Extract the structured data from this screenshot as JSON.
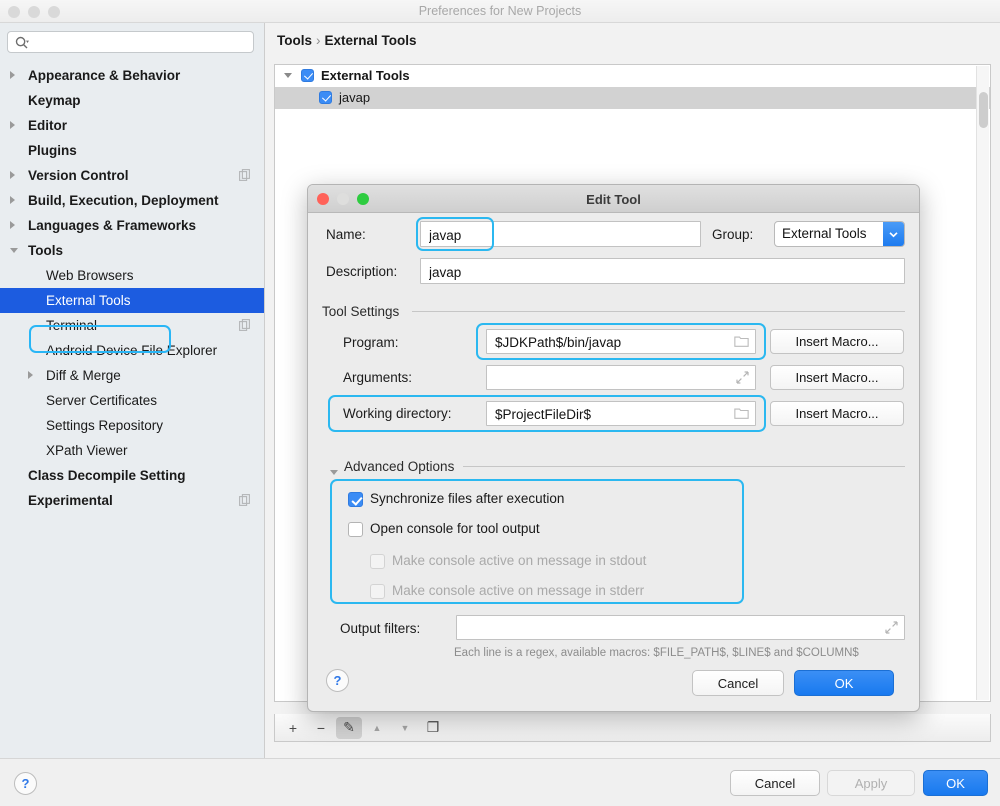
{
  "window": {
    "title": "Preferences for New Projects"
  },
  "search": {
    "value": "",
    "placeholder": ""
  },
  "sidebar": {
    "items": [
      {
        "label": "Appearance & Behavior",
        "level": "top",
        "arrow": "right",
        "bold": true,
        "copy": false,
        "selected": false
      },
      {
        "label": "Keymap",
        "level": "top",
        "arrow": "none",
        "bold": true,
        "copy": false,
        "selected": false
      },
      {
        "label": "Editor",
        "level": "top",
        "arrow": "right",
        "bold": true,
        "copy": false,
        "selected": false
      },
      {
        "label": "Plugins",
        "level": "top",
        "arrow": "none",
        "bold": true,
        "copy": false,
        "selected": false
      },
      {
        "label": "Version Control",
        "level": "top",
        "arrow": "right",
        "bold": true,
        "copy": true,
        "selected": false
      },
      {
        "label": "Build, Execution, Deployment",
        "level": "top",
        "arrow": "right",
        "bold": true,
        "copy": false,
        "selected": false
      },
      {
        "label": "Languages & Frameworks",
        "level": "top",
        "arrow": "right",
        "bold": true,
        "copy": false,
        "selected": false
      },
      {
        "label": "Tools",
        "level": "top",
        "arrow": "down",
        "bold": true,
        "copy": false,
        "selected": false
      },
      {
        "label": "Web Browsers",
        "level": "child",
        "arrow": "none",
        "bold": false,
        "copy": false,
        "selected": false
      },
      {
        "label": "External Tools",
        "level": "child",
        "arrow": "none",
        "bold": false,
        "copy": false,
        "selected": true
      },
      {
        "label": "Terminal",
        "level": "child",
        "arrow": "none",
        "bold": false,
        "copy": true,
        "selected": false
      },
      {
        "label": "Android Device File Explorer",
        "level": "child",
        "arrow": "none",
        "bold": false,
        "copy": false,
        "selected": false
      },
      {
        "label": "Diff & Merge",
        "level": "child",
        "arrow": "right",
        "bold": false,
        "copy": false,
        "selected": false
      },
      {
        "label": "Server Certificates",
        "level": "child",
        "arrow": "none",
        "bold": false,
        "copy": false,
        "selected": false
      },
      {
        "label": "Settings Repository",
        "level": "child",
        "arrow": "none",
        "bold": false,
        "copy": false,
        "selected": false
      },
      {
        "label": "XPath Viewer",
        "level": "child",
        "arrow": "none",
        "bold": false,
        "copy": false,
        "selected": false
      },
      {
        "label": "Class Decompile Setting",
        "level": "top",
        "arrow": "none",
        "bold": true,
        "copy": false,
        "selected": false
      },
      {
        "label": "Experimental",
        "level": "top",
        "arrow": "none",
        "bold": true,
        "copy": true,
        "selected": false
      }
    ]
  },
  "breadcrumb": {
    "parent": "Tools",
    "separator": "›",
    "current": "External Tools"
  },
  "tools_tree": {
    "rows": [
      {
        "label": "External Tools",
        "checked": true,
        "indent": 0,
        "expandable": true,
        "selected": false
      },
      {
        "label": "javap",
        "checked": true,
        "indent": 1,
        "expandable": false,
        "selected": true
      }
    ]
  },
  "tools_toolbar": {
    "buttons": [
      {
        "name": "add",
        "glyph": "+",
        "pressed": false
      },
      {
        "name": "remove",
        "glyph": "−",
        "pressed": false
      },
      {
        "name": "edit",
        "glyph": "✎",
        "pressed": true
      },
      {
        "name": "move-up",
        "glyph": "▲",
        "pressed": false
      },
      {
        "name": "move-down",
        "glyph": "▼",
        "pressed": false
      },
      {
        "name": "copy",
        "glyph": "❐",
        "pressed": false
      }
    ]
  },
  "bottom_bar": {
    "help": "?",
    "cancel": "Cancel",
    "apply": "Apply",
    "ok": "OK"
  },
  "dialog": {
    "title": "Edit Tool",
    "name_label": "Name:",
    "name_value": "javap",
    "group_label": "Group:",
    "group_value": "External Tools",
    "description_label": "Description:",
    "description_value": "javap",
    "tool_settings_title": "Tool Settings",
    "program_label": "Program:",
    "program_value": "$JDKPath$/bin/javap",
    "arguments_label": "Arguments:",
    "arguments_value": "",
    "working_dir_label": "Working directory:",
    "working_dir_value": "$ProjectFileDir$",
    "insert_macro_label": "Insert Macro...",
    "advanced_options_title": "Advanced Options",
    "checkboxes": [
      {
        "label": "Synchronize files after execution",
        "checked": true,
        "disabled": false
      },
      {
        "label": "Open console for tool output",
        "checked": false,
        "disabled": false
      },
      {
        "label": "Make console active on message in stdout",
        "checked": false,
        "disabled": true
      },
      {
        "label": "Make console active on message in stderr",
        "checked": false,
        "disabled": true
      }
    ],
    "output_filters_label": "Output filters:",
    "output_filters_value": "",
    "hint": "Each line is a regex, available macros: $FILE_PATH$, $LINE$ and $COLUMN$",
    "help": "?",
    "cancel": "Cancel",
    "ok": "OK"
  },
  "colors": {
    "annotation": "#2bb8f0",
    "selection": "#1c5ce0",
    "primary_button": "#1879ef",
    "checkbox_on": "#3b8cf5"
  }
}
